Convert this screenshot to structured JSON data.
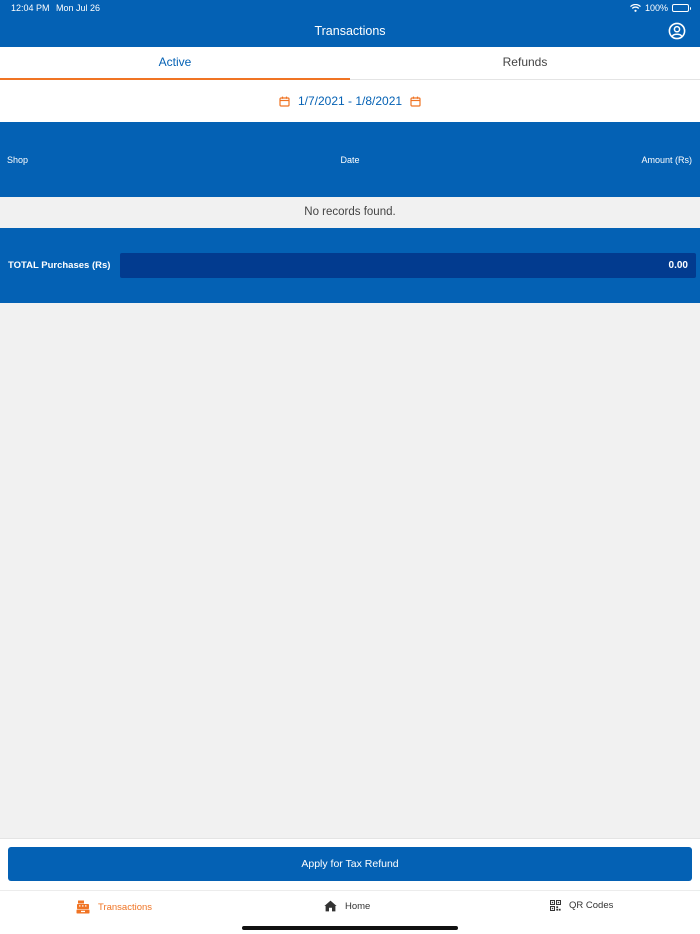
{
  "status_bar": {
    "time": "12:04 PM",
    "date": "Mon Jul 26",
    "battery": "100%"
  },
  "header": {
    "title": "Transactions",
    "profile_icon": "user-circle-icon"
  },
  "tabs": [
    {
      "label": "Active",
      "active": true
    },
    {
      "label": "Refunds",
      "active": false
    }
  ],
  "date_filter": {
    "range": "1/7/2021 - 1/8/2021",
    "icon": "calendar-icon"
  },
  "table": {
    "columns": [
      "Shop",
      "Date",
      "Amount (Rs)"
    ],
    "empty_message": "No records found."
  },
  "totals": {
    "label": "TOTAL Purchases (Rs)",
    "value": "0.00"
  },
  "footer": {
    "apply_label": "Apply for Tax Refund"
  },
  "tab_bar": [
    {
      "label": "Transactions",
      "icon": "cash-register-icon",
      "active": true
    },
    {
      "label": "Home",
      "icon": "home-icon",
      "active": false
    },
    {
      "label": "QR Codes",
      "icon": "qr-code-icon",
      "active": false
    }
  ],
  "colors": {
    "primary": "#0461b4",
    "primary_dark": "#023b8f",
    "accent": "#f07424",
    "background": "#f1f1f1"
  }
}
